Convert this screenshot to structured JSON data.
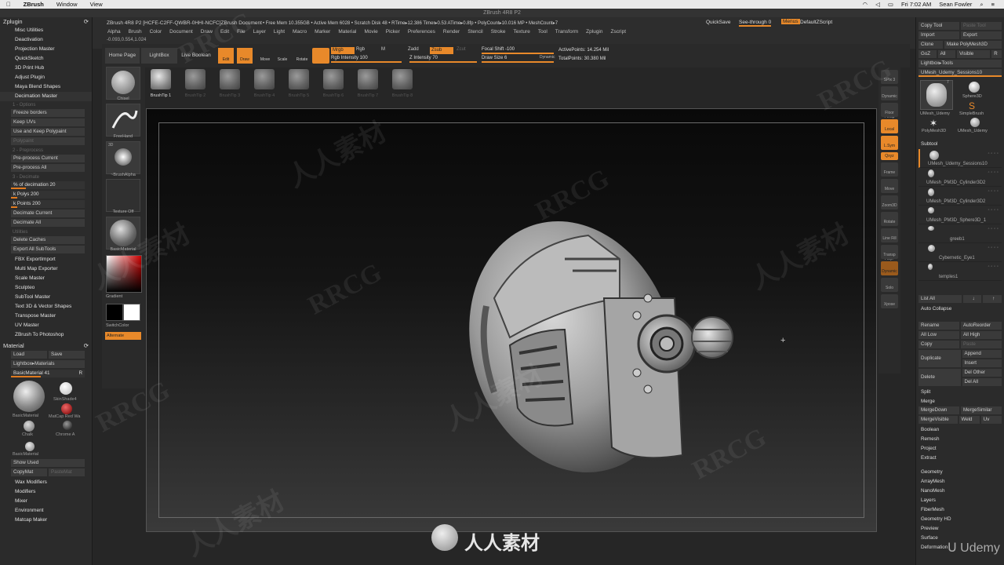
{
  "os": {
    "apple": "",
    "app": "ZBrush",
    "menus": [
      "Window",
      "View"
    ],
    "clock": "Fri 7:02 AM",
    "user": "Sean Fowler"
  },
  "window": {
    "title": "ZBrush 4R8 P2"
  },
  "doc_info": {
    "title": "ZBrush 4R8 P2 [HCFE-C2FF-QWBR-0HHI-NCFC]ZBrush Document",
    "stats": "• Free Mem 10.355GB • Active Mem 6028 • Scratch Disk 48 • RTime▸12.386 Timer▸0.53 ATime▸0.8fp • PolyCount▸10.016 MP • MeshCount▸7",
    "quicksave": "QuickSave",
    "seethrough": "See-through  0",
    "menus_btn": "Menus",
    "defaultzscript": "DefaultZScript"
  },
  "coords": "-0.093,0.554,1.024",
  "menubar": [
    "Alpha",
    "Brush",
    "Color",
    "Document",
    "Draw",
    "Edit",
    "File",
    "Layer",
    "Light",
    "Macro",
    "Marker",
    "Material",
    "Movie",
    "Picker",
    "Preferences",
    "Render",
    "Stencil",
    "Stroke",
    "Texture",
    "Tool",
    "Transform",
    "Zplugin",
    "Zscript"
  ],
  "toolbar": {
    "home": "Home Page",
    "lightbox": "LightBox",
    "liveboolean": "Live Boolean",
    "edit": "Edit",
    "draw": "Draw",
    "move": "Move",
    "scale": "Scale",
    "rotate": "Rotate",
    "mrgb": "Mrgb",
    "rgb": "Rgb",
    "m": "M",
    "rgb_intensity": "Rgb Intensity 100",
    "zadd": "Zadd",
    "zsub": "Zsub",
    "zcut": "Zcut",
    "z_intensity": "Z Intensity 70",
    "focal_shift": "Focal Shift -100",
    "draw_size": "Draw Size 6",
    "dynamic": "Dynamic",
    "active_points": "ActivePoints: 14.254 Mil",
    "total_points": "TotalPoints: 30.380 Mil"
  },
  "brushtips": [
    "BrushTip 1",
    "BrushTip 2",
    "BrushTip 3",
    "BrushTip 4",
    "BrushTip 5",
    "BrushTip 6",
    "BrushTip 7",
    "BrushTip 8"
  ],
  "lcol": {
    "chisel": "Chisel",
    "freehand": "FreeHand",
    "alpha": "~BrushAlpha",
    "alpha_3d": "3D",
    "texture": "Texture Off",
    "material": "BasicMaterial",
    "gradient": "Gradient",
    "switchcolor": "SwitchColor",
    "alternate": "Alternate"
  },
  "zplugin": {
    "header": "Zplugin",
    "items": [
      "Misc Utilities",
      "Deactivation",
      "Projection Master",
      "QuickSketch",
      "3D Print Hub",
      "Adjust Plugin",
      "Maya Blend Shapes",
      "Decimation Master"
    ],
    "options_label": "1 - Options",
    "freeze": "Freeze borders",
    "keepuv": "Keep UVs",
    "keeppoly": "Use and Keep Polypaint",
    "polypaint_dim": "Polypaint",
    "preprocess_label": "2 - Preprocess",
    "pre_current": "Pre-process Current",
    "pre_all": "Pre-process All",
    "decimate_label": "3 - Decimate",
    "pct": "% of decimation 20",
    "kpolys": "k Polys 200",
    "kpoints": "k Points 200",
    "dec_current": "Decimate Current",
    "dec_all": "Decimate All",
    "utilities_label": "Utilities",
    "delete_caches": "Delete Caches",
    "export_subtools": "Export All SubTools",
    "more": [
      "FBX ExportImport",
      "Multi Map Exporter",
      "Scale Master",
      "Sculpteo",
      "SubTool Master",
      "Text 3D & Vector Shapes",
      "Transpose Master",
      "UV Master",
      "ZBrush To Photoshop"
    ]
  },
  "material": {
    "header": "Material",
    "load": "Load",
    "save": "Save",
    "lightbox": "Lightbox▸Materials",
    "current": "BasicMaterial  41",
    "r": "R",
    "mats": [
      "BasicMaterial",
      "SkinShade4",
      "MatCap Red Wa",
      "Chalk",
      "Chrome A",
      "BasicMaterial"
    ],
    "showused": "Show Used",
    "copymat": "CopyMat",
    "pastemat": "PasteMat",
    "more": [
      "Wax Modifiers",
      "Modifiers",
      "Mixer",
      "Environment",
      "Matcap Maker"
    ]
  },
  "rshelf": [
    "SPix 3",
    "Dynamic Persp",
    "Floor",
    "Local",
    "L.Sym",
    "Qxyz",
    "Frame",
    "Move",
    "Zoom3D",
    "Rotate",
    "Line Fill PolyF",
    "Transp",
    "Dynamic",
    "Solo",
    "Xpose"
  ],
  "rpanel": {
    "copytool": "Copy Tool",
    "pastetool": "Paste Tool",
    "import": "Import",
    "export": "Export",
    "clone": "Clone",
    "makepoly": "Make PolyMesh3D",
    "goz": "GoZ",
    "all": "All",
    "visible": "Visible",
    "r": "R",
    "lightbox_tools": "Lightbox▸Tools",
    "current_tool": "UMesh_Udemy_Sessions10",
    "tools": [
      "UMesh_Udemy",
      "Sphere3D",
      "SimpleBrush",
      "PolyMesh3D",
      "UMesh_Udemy"
    ],
    "tool_num": "7",
    "subtool_header": "Subtool",
    "subtools": [
      "UMesh_Udemy_Sessions10",
      "UMesh_PM3D_Cylinder3D2",
      "UMesh_PM3D_Cylinder3D2",
      "UMesh_PM3D_Sphere3D_1",
      "greeb1",
      "Cybernetic_Eye1",
      "temples1"
    ],
    "listall": "List All",
    "autocollapse": "Auto Collapse",
    "rename": "Rename",
    "autoreorder": "AutoReorder",
    "alllow": "All Low",
    "allhigh": "All High",
    "copy": "Copy",
    "paste": "Paste",
    "duplicate": "Duplicate",
    "append": "Append",
    "insert": "Insert",
    "delete": "Delete",
    "delother": "Del Other",
    "delall": "Del All",
    "split": "Split",
    "merge": "Merge",
    "mergedown": "MergeDown",
    "mergesimilar": "MergeSimilar",
    "mergevisible": "MergeVisible",
    "weld": "Weld",
    "uv": "Uv",
    "boolean": "Boolean",
    "remesh": "Remesh",
    "project": "Project",
    "extract": "Extract",
    "more": [
      "Geometry",
      "ArrayMesh",
      "NanoMesh",
      "Layers",
      "FiberMesh",
      "Geometry HD",
      "Preview",
      "Surface",
      "Deformation"
    ]
  },
  "watermarks": [
    "RRCG",
    "人人素材",
    "RRCG",
    "人人素材",
    "RRCG",
    "人人素材",
    "RRCG",
    "人人素材",
    "RRCG",
    "人人素材",
    "RRCG"
  ],
  "footer": {
    "logo_text": "人人素材",
    "udemy": "Udemy"
  },
  "colors": {
    "accent": "#e8892a",
    "bg": "#262626"
  }
}
